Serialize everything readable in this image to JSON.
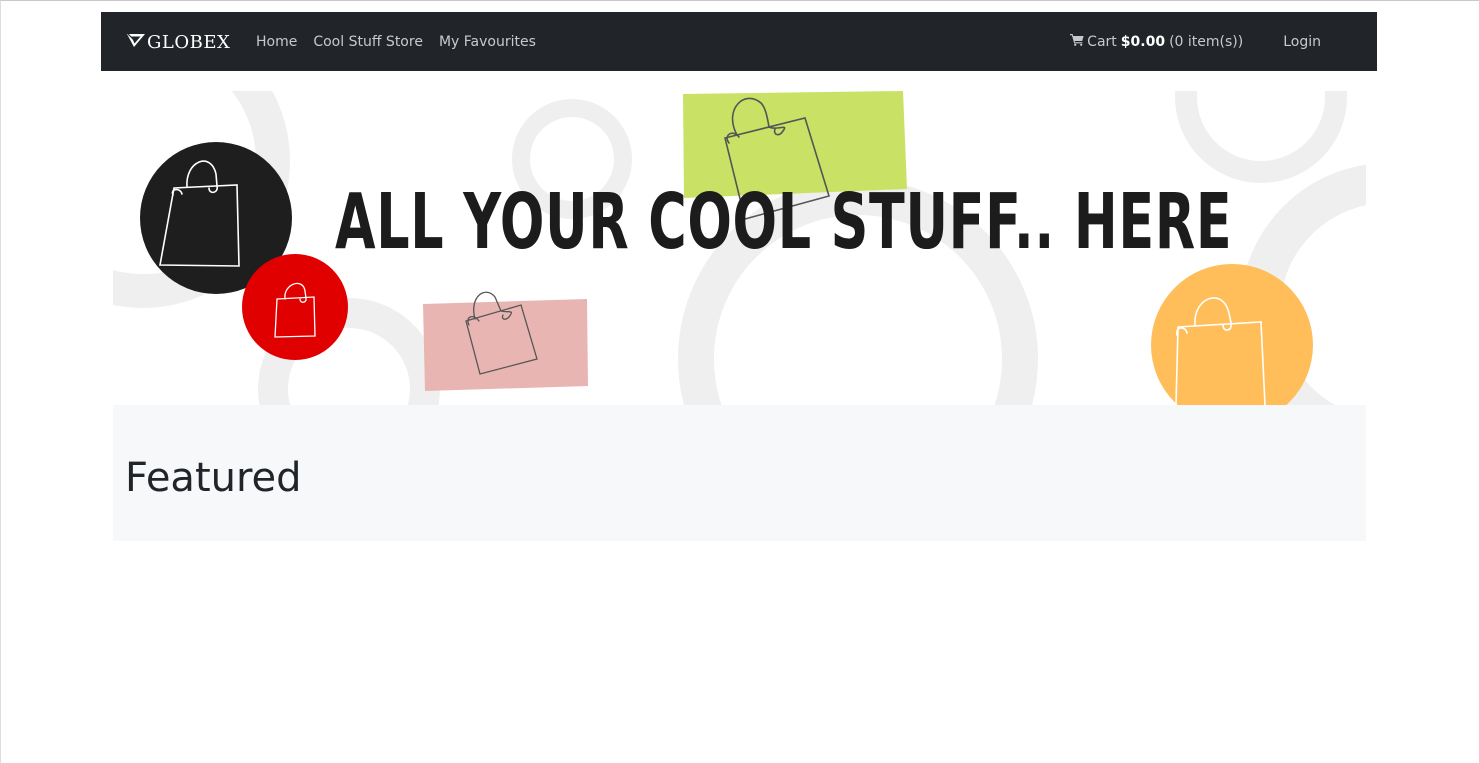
{
  "navbar": {
    "brand": "GLOBEX",
    "links": [
      "Home",
      "Cool Stuff Store",
      "My Favourites"
    ],
    "cart": {
      "icon": "shopping-cart-icon",
      "label": "Cart",
      "amount": "$0.00",
      "count": "(0 item(s))"
    },
    "login": "Login",
    "background_color": "#212529"
  },
  "banner": {
    "headline": "ALL YOUR COOL STUFF.. HERE",
    "icons": [
      "shopping-bag-icon"
    ],
    "colors": {
      "black_circle": "#1e1e1e",
      "red_circle": "#e00000",
      "green_block": "#c9e265",
      "pink_block": "#e8b5b2",
      "orange_circle": "#ffbe5a",
      "background_rings": "#efefef"
    }
  },
  "featured": {
    "title": "Featured",
    "background_color": "#f7f8fa"
  }
}
